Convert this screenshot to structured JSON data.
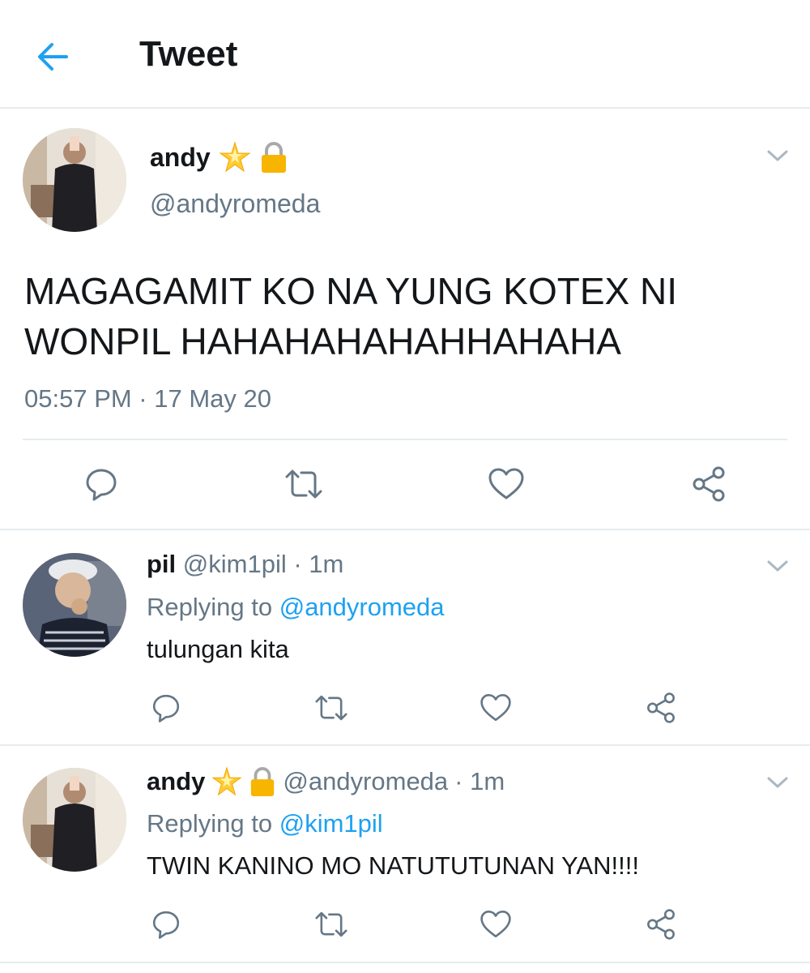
{
  "header": {
    "title": "Tweet",
    "back_icon": "arrow-left-icon"
  },
  "colors": {
    "accent": "#1da1f2",
    "text": "#14171a",
    "secondary": "#657786",
    "divider": "#e6ecf0"
  },
  "main_tweet": {
    "name": "andy",
    "badges": [
      "sparkle-star-emoji",
      "lock-icon"
    ],
    "handle": "@andyromeda",
    "text_line1": "MAGAGAMIT KO NA YUNG KOTEX NI",
    "text_line2": "WONPIL HAHAHAHAHAHHAHAHA",
    "timestamp": "05:57 PM · 17 May 20"
  },
  "replies": [
    {
      "name": "pil",
      "handle": "@kim1pil",
      "time": "· 1m",
      "replying_to_label": "Replying to",
      "replying_to_handle": "@andyromeda",
      "text": "tulungan kita"
    },
    {
      "name": "andy",
      "handle": "@andyromeda",
      "time": "· 1m",
      "replying_to_label": "Replying to",
      "replying_to_handle": "@kim1pil",
      "text": "TWIN KANINO MO NATUTUTUNAN YAN!!!!"
    }
  ],
  "actions": [
    "reply-icon",
    "retweet-icon",
    "like-icon",
    "share-icon"
  ]
}
